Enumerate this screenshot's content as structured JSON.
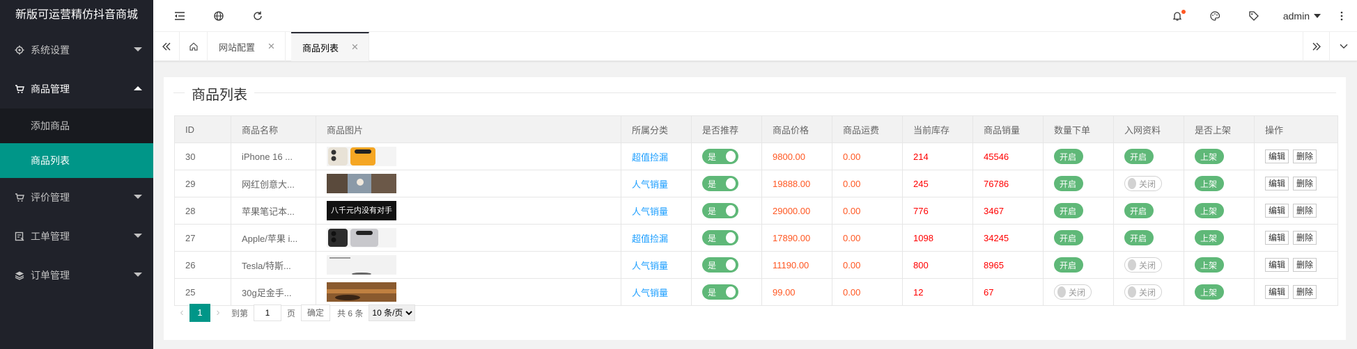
{
  "app_title": "新版可运营精仿抖音商城",
  "sidebar": {
    "items": [
      {
        "label": "系统设置",
        "icon": "gear-icon"
      },
      {
        "label": "商品管理",
        "icon": "cart-icon",
        "open": true,
        "children": [
          {
            "label": "添加商品"
          },
          {
            "label": "商品列表",
            "active": true
          }
        ]
      },
      {
        "label": "评价管理",
        "icon": "cart-icon"
      },
      {
        "label": "工单管理",
        "icon": "ticket-icon"
      },
      {
        "label": "订单管理",
        "icon": "layers-icon"
      }
    ]
  },
  "header": {
    "user": "admin"
  },
  "tabs": [
    {
      "label": "网站配置"
    },
    {
      "label": "商品列表",
      "active": true
    }
  ],
  "page": {
    "title": "商品列表"
  },
  "table": {
    "columns": [
      "ID",
      "商品名称",
      "商品图片",
      "所属分类",
      "是否推荐",
      "商品价格",
      "商品运费",
      "当前库存",
      "商品销量",
      "数量下单",
      "入网资料",
      "是否上架",
      "操作"
    ],
    "rows": [
      {
        "id": "30",
        "name": "iPhone 16 ...",
        "img": "phone",
        "category": "超值捡漏",
        "recommend": "是",
        "price": "9800.00",
        "shipping": "0.00",
        "stock": "214",
        "sales": "45546",
        "qty_order": "on",
        "net_info": "on",
        "listed": "上架"
      },
      {
        "id": "29",
        "name": "网红创意大...",
        "img": "room",
        "category": "人气销量",
        "recommend": "是",
        "price": "19888.00",
        "shipping": "0.00",
        "stock": "245",
        "sales": "76786",
        "qty_order": "on",
        "net_info": "off",
        "listed": "上架"
      },
      {
        "id": "28",
        "name": "苹果笔记本...",
        "img": "banner",
        "img_text": "八千元内没有对手",
        "category": "人气销量",
        "recommend": "是",
        "price": "29000.00",
        "shipping": "0.00",
        "stock": "776",
        "sales": "3467",
        "qty_order": "on",
        "net_info": "on",
        "listed": "上架"
      },
      {
        "id": "27",
        "name": "Apple/苹果 i...",
        "img": "phone2",
        "category": "超值捡漏",
        "recommend": "是",
        "price": "17890.00",
        "shipping": "0.00",
        "stock": "1098",
        "sales": "34245",
        "qty_order": "on",
        "net_info": "on",
        "listed": "上架"
      },
      {
        "id": "26",
        "name": "Tesla/特斯...",
        "img": "white",
        "category": "人气销量",
        "recommend": "是",
        "price": "11190.00",
        "shipping": "0.00",
        "stock": "800",
        "sales": "8965",
        "qty_order": "on",
        "net_info": "off",
        "listed": "上架"
      },
      {
        "id": "25",
        "name": "30g足金手...",
        "img": "gold",
        "category": "人气销量",
        "recommend": "是",
        "price": "99.00",
        "shipping": "0.00",
        "stock": "12",
        "sales": "67",
        "qty_order": "off",
        "net_info": "off",
        "listed": "上架"
      }
    ],
    "switch_on": "开启",
    "switch_off": "关闭",
    "edit_label": "编辑",
    "delete_label": "删除"
  },
  "pagination": {
    "current": "1",
    "goto_label": "到第",
    "goto_value": "1",
    "page_unit": "页",
    "confirm": "确定",
    "total": "共 6 条",
    "page_size": "10 条/页"
  },
  "colors": {
    "sidebar_bg": "#20222a",
    "accent": "#009688",
    "switch_on": "#5fb878",
    "link": "#1e9fff",
    "price": "#ff5722"
  }
}
